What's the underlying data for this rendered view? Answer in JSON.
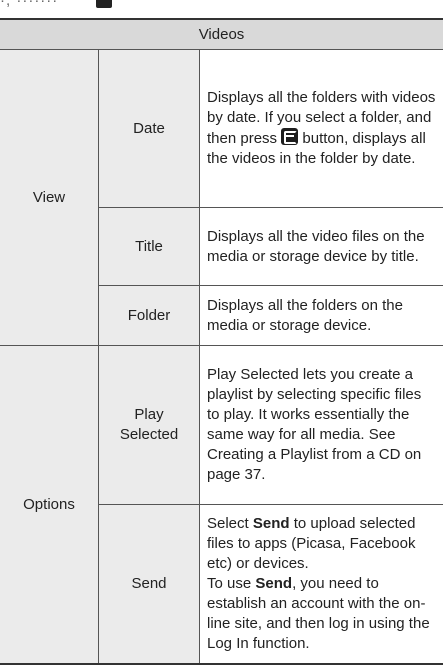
{
  "top_fragment": {
    "text": "·, ·······"
  },
  "table": {
    "title": "Videos",
    "sections": [
      {
        "label": "View",
        "rows": [
          {
            "name": "Date",
            "desc_part1": "Displays all the folders with videos by date. If you select a folder, and then press ",
            "button_icon": "enter-button-icon",
            "desc_part2": " button, displays all the videos in the folder by date."
          },
          {
            "name": "Title",
            "desc": "Displays all the video files on the media or storage device by title."
          },
          {
            "name": "Folder",
            "desc": "Displays all the folders on the media or storage device."
          }
        ]
      },
      {
        "label": "Options",
        "rows": [
          {
            "name": "Play Selected",
            "desc": "Play Selected lets you create a playlist by selecting specific files to play. It works essentially the same way for all media. See Creating a Playlist from a CD on page 37."
          },
          {
            "name": "Send",
            "desc_l1_pre": "Select ",
            "desc_l1_bold": "Send",
            "desc_l1_post": " to upload selected files to apps (Picasa, Facebook etc) or devices.",
            "desc_l2_pre": "To use ",
            "desc_l2_bold": "Send",
            "desc_l2_post": ", you need to establish an account with the on-line site, and then log in using the Log In function."
          }
        ]
      }
    ]
  },
  "colors": {
    "header_bg": "#d9d9d9",
    "label_bg": "#ebebeb",
    "border": "#555555",
    "rule": "#333333"
  }
}
